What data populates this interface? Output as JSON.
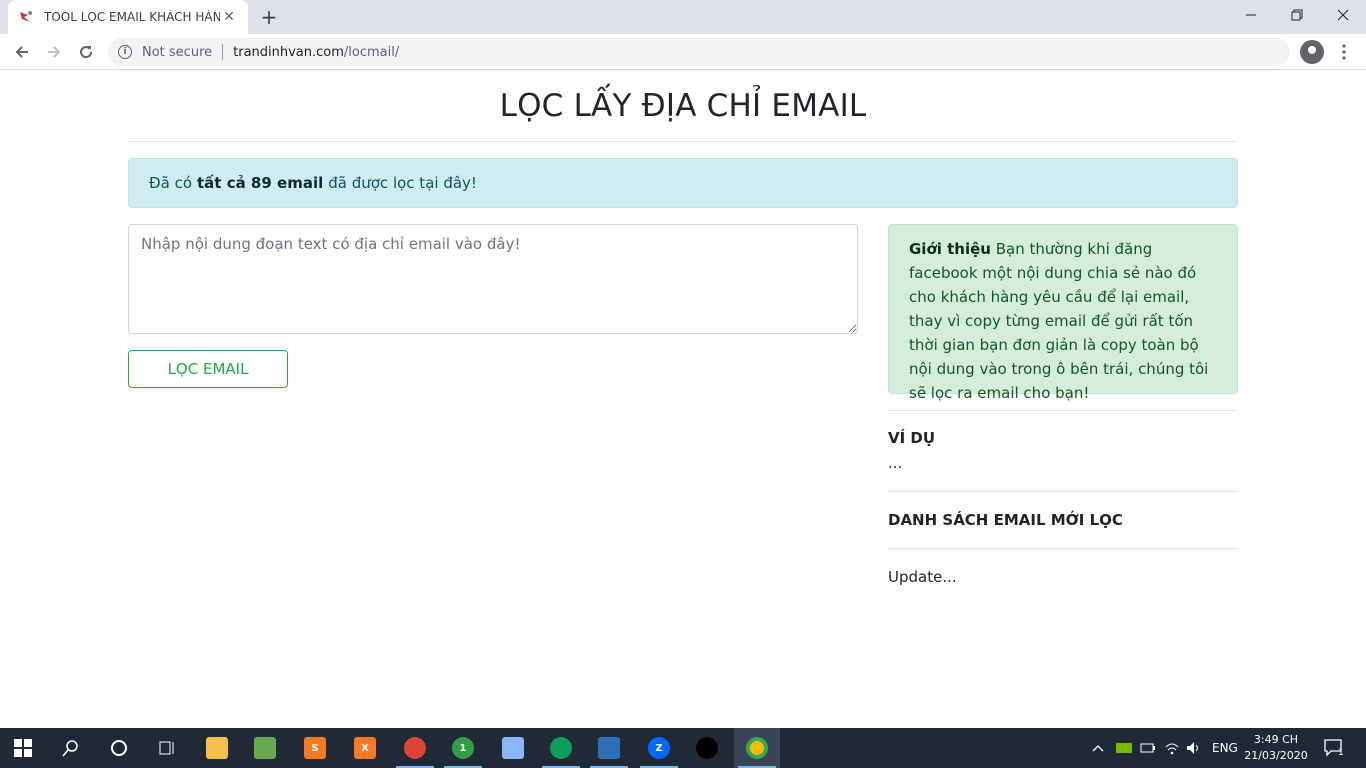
{
  "browser": {
    "tab_title": "TOOL LỌC EMAIL KHÁCH HÀNG",
    "tab_close": "✕",
    "new_tab": "+",
    "security_label": "Not secure",
    "url_host": "trandinhvan.com",
    "url_path": "/locmail/"
  },
  "page": {
    "title": "LỌC LẤY ĐỊA CHỈ EMAIL",
    "info_prefix": "Đã có",
    "info_bold": "tất cả 89 email",
    "info_suffix": "đã được lọc tại đây!",
    "textarea_placeholder": "Nhập nội dung đoạn text có địa chỉ email vào đây!",
    "filter_button": "LỌC EMAIL",
    "intro_label": "Giới thiệu",
    "intro_text": "Bạn thường khi đăng facebook một nội dung chia sẻ nào đó cho khách hàng yêu cầu để lại email, thay vì copy từng email để gửi rất tốn thời gian bạn đơn giản là copy toàn bộ nội dung vào trong ô bên trái, chúng tôi sẽ lọc ra email cho bạn!",
    "example_heading": "VÍ DỤ",
    "example_text": "...",
    "list_heading": "DANH SÁCH EMAIL MỚI LỌC",
    "list_text": "Update..."
  },
  "taskbar": {
    "language": "ENG",
    "time": "3:49 CH",
    "date": "21/03/2020",
    "notification_count": "1",
    "app_badge": "1"
  }
}
